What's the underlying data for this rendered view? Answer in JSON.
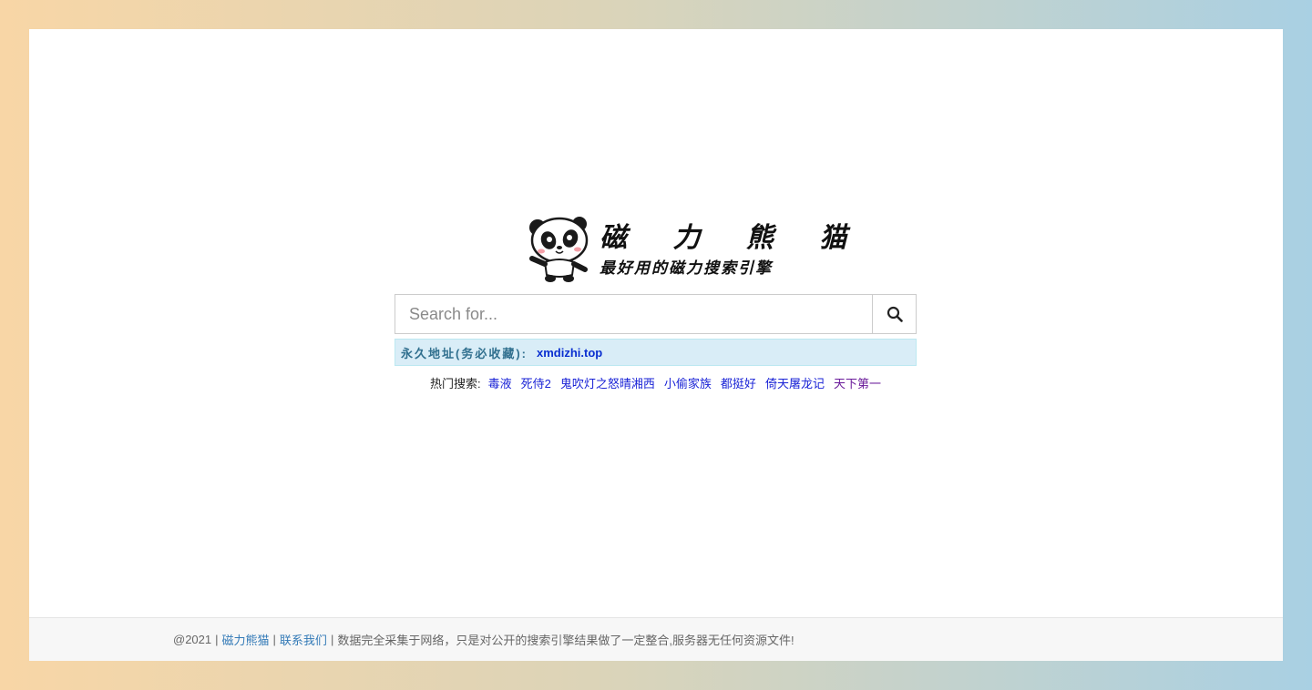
{
  "logo": {
    "title": "磁 力 熊 猫",
    "subtitle": "最好用的磁力搜索引擎",
    "mascot_icon": "panda-icon"
  },
  "search": {
    "placeholder": "Search for...",
    "value": "",
    "button_icon": "search-icon"
  },
  "notice": {
    "label": "永久地址(务必收藏):",
    "link_text": "xmdizhi.top",
    "bg_color": "#d9edf7",
    "label_color": "#31708f"
  },
  "hot_search": {
    "label": "热门搜索:",
    "items": [
      "毒液",
      "死侍2",
      "鬼吹灯之怒晴湘西",
      "小偷家族",
      "都挺好",
      "倚天屠龙记",
      "天下第一"
    ]
  },
  "footer": {
    "copyright": "@2021",
    "site_link": "磁力熊猫",
    "contact_link": "联系我们",
    "disclaimer": "数据完全采集于网络，只是对公开的搜索引擎结果做了一定整合,服务器无任何资源文件!",
    "divider": "|"
  }
}
